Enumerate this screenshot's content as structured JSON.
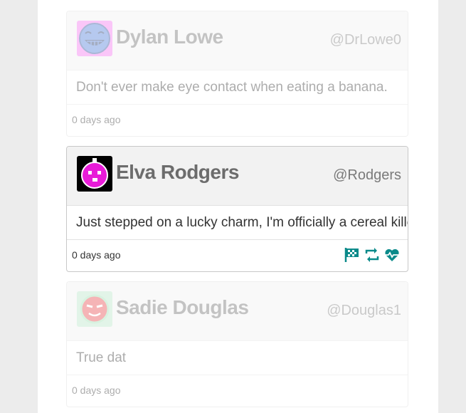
{
  "tweets": [
    {
      "name": "Dylan Lowe",
      "handle": "@DrLowe0",
      "text": "Don't ever make eye contact when eating a banana.",
      "time": "0 days ago"
    },
    {
      "name": "Elva Rodgers",
      "handle": "@Rodgers",
      "text": "Just stepped on a lucky charm, I'm officially a cereal killer.",
      "time": "0 days ago"
    },
    {
      "name": "Sadie Douglas",
      "handle": "@Douglas1",
      "text": "True dat",
      "time": "0 days ago"
    }
  ],
  "icons": {
    "flag": "flag-icon",
    "retweet": "retweet-icon",
    "like": "heartbeat-icon"
  },
  "colors": {
    "action": "#0b8a8a",
    "avatar1_bg": "#f472f0",
    "avatar1_face": "#4a79d9",
    "avatar2_bg": "#000000",
    "avatar2_face": "#e81bd8",
    "avatar3_bg": "#b8e6c8",
    "avatar3_face": "#e8474a"
  }
}
